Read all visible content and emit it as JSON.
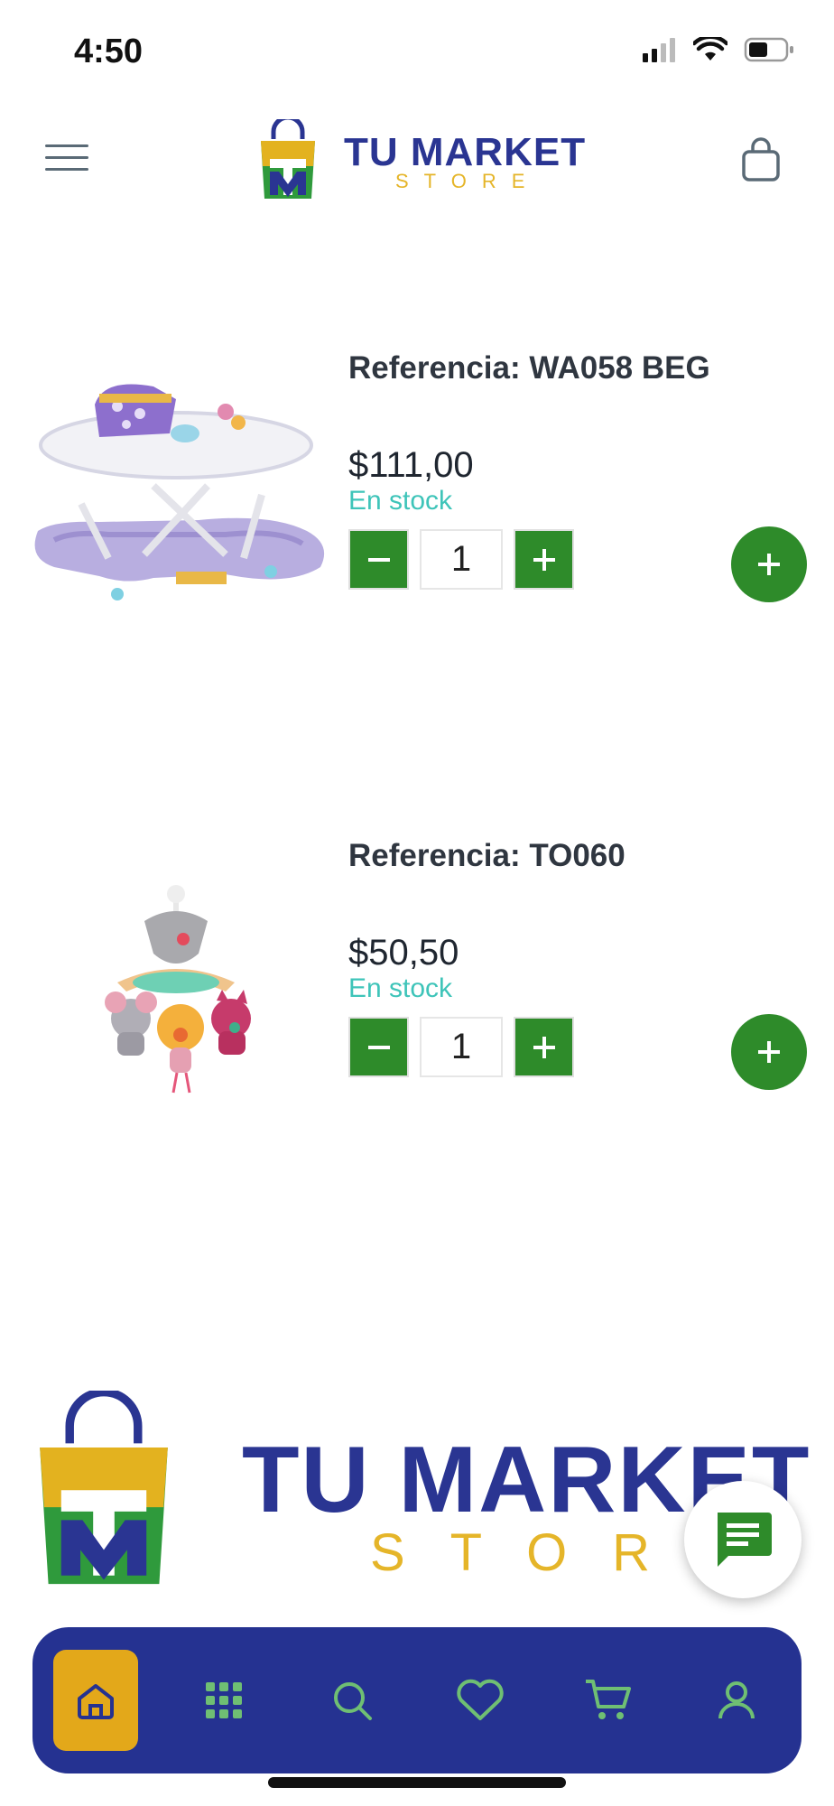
{
  "status_bar": {
    "time": "4:50"
  },
  "header": {
    "logo_title": "TU MARKET",
    "logo_subtitle": "STORE",
    "menu_icon": "hamburger-icon",
    "cart_icon": "shopping-bag-icon"
  },
  "products": [
    {
      "reference": "Referencia: WA058 BEG",
      "price": "$111,00",
      "stock": "En stock",
      "quantity": "1",
      "image_icon": "baby-walker-image"
    },
    {
      "reference": "Referencia: TO060",
      "price": "$50,50",
      "stock": "En stock",
      "quantity": "1",
      "image_icon": "baby-mobile-toy-image"
    }
  ],
  "footer_logo": {
    "title": "TU MARKET",
    "subtitle": "STORE"
  },
  "bottom_nav": {
    "items": [
      {
        "icon": "home-icon",
        "active": true
      },
      {
        "icon": "grid-icon",
        "active": false
      },
      {
        "icon": "search-icon",
        "active": false
      },
      {
        "icon": "heart-icon",
        "active": false
      },
      {
        "icon": "cart-icon",
        "active": false
      },
      {
        "icon": "user-icon",
        "active": false
      }
    ]
  },
  "colors": {
    "brand_blue": "#253291",
    "brand_yellow": "#e5b529",
    "action_green": "#2e8b2a",
    "stock_teal": "#3ec4b9",
    "nav_active": "#e3a81a"
  }
}
